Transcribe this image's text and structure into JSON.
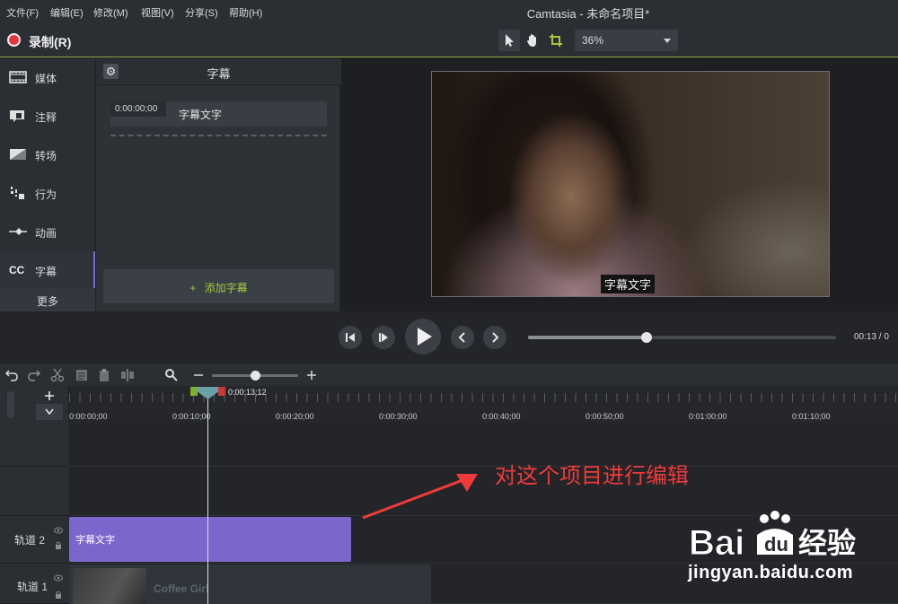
{
  "menu": {
    "items": [
      "文件(F)",
      "编辑(E)",
      "修改(M)",
      "视图(V)",
      "分享(S)",
      "帮助(H)"
    ],
    "title": "Camtasia - 未命名项目*"
  },
  "toolbar": {
    "record_label": "录制(R)",
    "zoom_value": "36%"
  },
  "sidebar": {
    "items": [
      {
        "label": "媒体",
        "icon": "film-icon"
      },
      {
        "label": "注释",
        "icon": "callout-icon"
      },
      {
        "label": "转场",
        "icon": "transition-icon"
      },
      {
        "label": "行为",
        "icon": "behavior-icon"
      },
      {
        "label": "动画",
        "icon": "animation-icon"
      },
      {
        "label": "字幕",
        "icon": "cc-icon"
      }
    ],
    "cc_glyph": "CC",
    "more_label": "更多"
  },
  "panel": {
    "title": "字幕",
    "caption_time": "0:00:00;00",
    "caption_text": "字幕文字",
    "add_label": "添加字幕",
    "add_glyph": "+"
  },
  "canvas": {
    "subtitle": "字幕文字"
  },
  "playback": {
    "time": "00:13 / 0",
    "progress": 0.385
  },
  "timeline": {
    "zoom_level": 0.5,
    "playhead_time": "0:00:13;12",
    "ticks": [
      "0:00:00;00",
      "0:00:10;00",
      "0:00:20;00",
      "0:00:30;00",
      "0:00:40;00",
      "0:00:50;00",
      "0:01:00;00",
      "0:01:10;00"
    ],
    "tracks": [
      {
        "label": "轨道 2",
        "clip": "字幕文字"
      },
      {
        "label": "轨道 1",
        "clip": "Coffee Girl"
      }
    ]
  },
  "annotation": {
    "text": "对这个项目进行编辑",
    "color": "#f03a3a"
  },
  "watermark": {
    "logo_text": "Bai 经验",
    "url": "jingyan.baidu.com"
  },
  "colors": {
    "accent_green": "#a3c940",
    "caption_clip": "#7b66cc",
    "record_red": "#e8373a"
  }
}
